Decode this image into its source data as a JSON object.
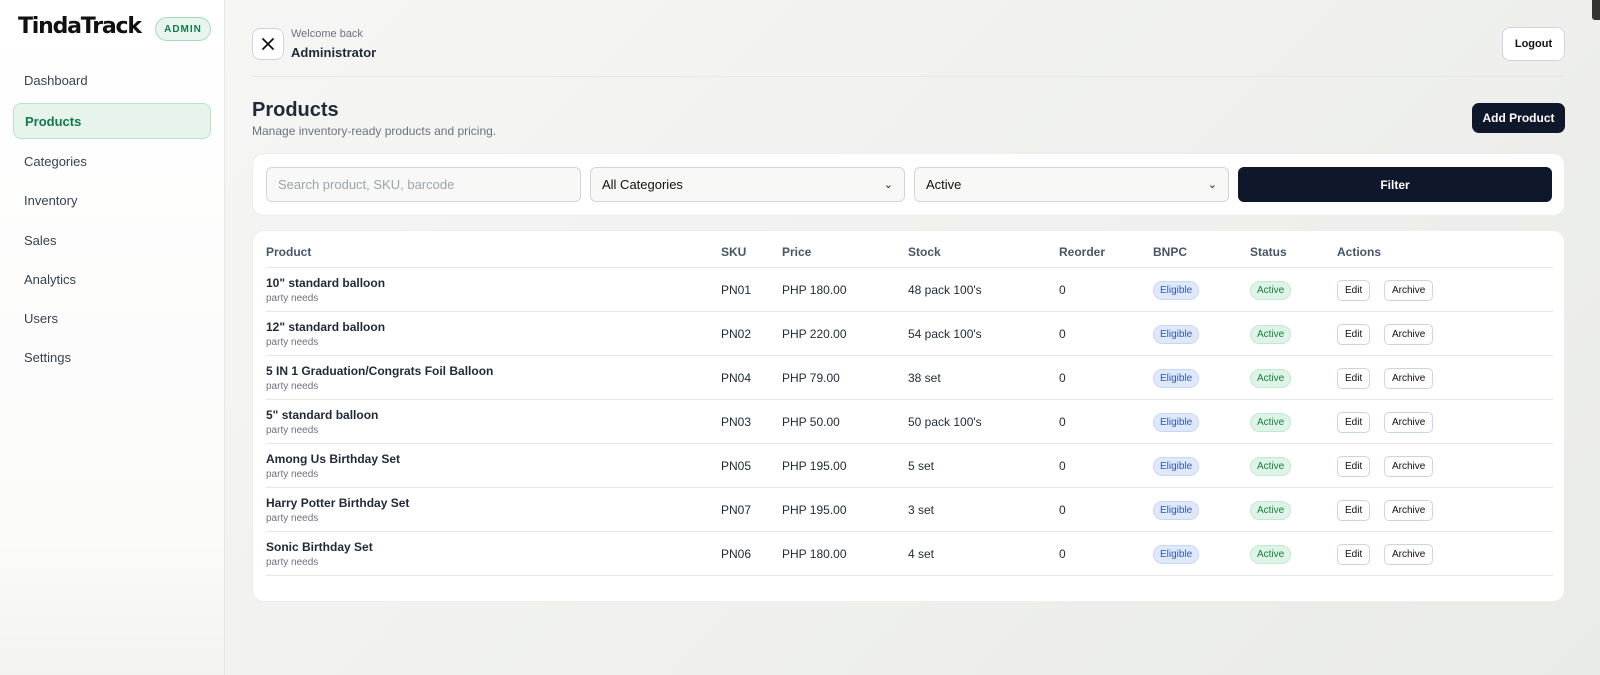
{
  "brand": {
    "name": "TindaTrack",
    "role_badge": "ADMIN"
  },
  "sidebar": {
    "items": [
      {
        "label": "Dashboard",
        "active": false
      },
      {
        "label": "Products",
        "active": true
      },
      {
        "label": "Categories",
        "active": false
      },
      {
        "label": "Inventory",
        "active": false
      },
      {
        "label": "Sales",
        "active": false
      },
      {
        "label": "Analytics",
        "active": false
      },
      {
        "label": "Users",
        "active": false
      },
      {
        "label": "Settings",
        "active": false
      }
    ]
  },
  "header": {
    "welcome_text": "Welcome back",
    "user_name": "Administrator",
    "logout_label": "Logout"
  },
  "page": {
    "title": "Products",
    "subtitle": "Manage inventory-ready products and pricing.",
    "add_button": "Add Product"
  },
  "filters": {
    "search_placeholder": "Search product, SKU, barcode",
    "category_selected": "All Categories",
    "status_selected": "Active",
    "filter_button": "Filter"
  },
  "table": {
    "columns": [
      "Product",
      "SKU",
      "Price",
      "Stock",
      "Reorder",
      "BNPC",
      "Status",
      "Actions"
    ],
    "action_labels": {
      "edit": "Edit",
      "archive": "Archive"
    },
    "rows": [
      {
        "name": "10\" standard balloon",
        "category": "party needs",
        "sku": "PN01",
        "price": "PHP 180.00",
        "stock": "48 pack 100's",
        "reorder": "0",
        "bnpc": "Eligible",
        "status": "Active"
      },
      {
        "name": "12\" standard balloon",
        "category": "party needs",
        "sku": "PN02",
        "price": "PHP 220.00",
        "stock": "54 pack 100's",
        "reorder": "0",
        "bnpc": "Eligible",
        "status": "Active"
      },
      {
        "name": "5 IN 1 Graduation/Congrats Foil Balloon",
        "category": "party needs",
        "sku": "PN04",
        "price": "PHP 79.00",
        "stock": "38 set",
        "reorder": "0",
        "bnpc": "Eligible",
        "status": "Active"
      },
      {
        "name": "5\" standard balloon",
        "category": "party needs",
        "sku": "PN03",
        "price": "PHP 50.00",
        "stock": "50 pack 100's",
        "reorder": "0",
        "bnpc": "Eligible",
        "status": "Active"
      },
      {
        "name": "Among Us Birthday Set",
        "category": "party needs",
        "sku": "PN05",
        "price": "PHP 195.00",
        "stock": "5 set",
        "reorder": "0",
        "bnpc": "Eligible",
        "status": "Active"
      },
      {
        "name": "Harry Potter Birthday Set",
        "category": "party needs",
        "sku": "PN07",
        "price": "PHP 195.00",
        "stock": "3 set",
        "reorder": "0",
        "bnpc": "Eligible",
        "status": "Active"
      },
      {
        "name": "Sonic Birthday Set",
        "category": "party needs",
        "sku": "PN06",
        "price": "PHP 180.00",
        "stock": "4 set",
        "reorder": "0",
        "bnpc": "Eligible",
        "status": "Active"
      }
    ]
  },
  "colors": {
    "accent_green": "#0f7a4d",
    "primary_dark": "#0f172a",
    "badge_blue": "#2f57b8"
  }
}
